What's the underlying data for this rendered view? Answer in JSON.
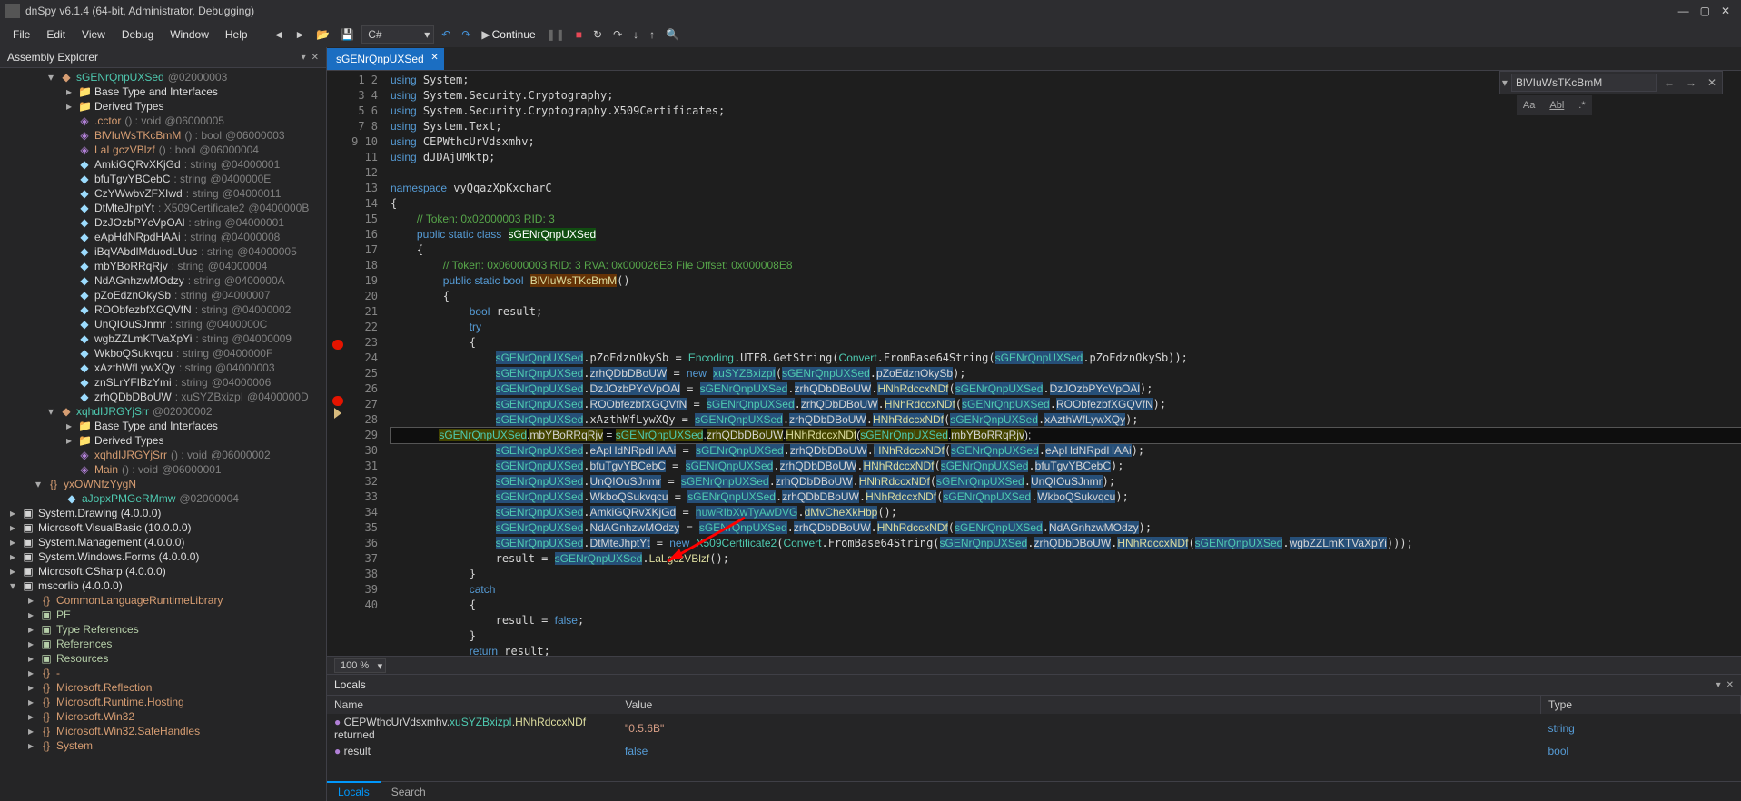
{
  "title": "dnSpy v6.1.4 (64-bit, Administrator, Debugging)",
  "menu": [
    "File",
    "Edit",
    "View",
    "Debug",
    "Window",
    "Help"
  ],
  "toolbar_lang": "C#",
  "continue_label": "Continue",
  "assembly_explorer": {
    "title": "Assembly Explorer",
    "root": {
      "name": "sGENrQnpUXSed",
      "token": "@02000003"
    },
    "base_if_label": "Base Type and Interfaces",
    "derived_label": "Derived Types",
    "members": [
      {
        "glyph": "◈",
        "name": ".cctor",
        "sig": "() : void",
        "tok": "@06000005",
        "color": "violet"
      },
      {
        "glyph": "◈",
        "name": "BlVIuWsTKcBmM",
        "sig": "() : bool",
        "tok": "@06000003",
        "color": "violet"
      },
      {
        "glyph": "◈",
        "name": "LaLgczVBlzf",
        "sig": "() : bool",
        "tok": "@06000004",
        "color": "violet"
      },
      {
        "glyph": "◆",
        "name": "AmkiGQRvXKjGd",
        "sig": " : string",
        "tok": "@04000001",
        "color": "cyan"
      },
      {
        "glyph": "◆",
        "name": "bfuTgvYBCebC",
        "sig": " : string",
        "tok": "@0400000E",
        "color": "cyan"
      },
      {
        "glyph": "◆",
        "name": "CzYWwbvZFXIwd",
        "sig": " : string",
        "tok": "@04000011",
        "color": "cyan"
      },
      {
        "glyph": "◆",
        "name": "DtMteJhptYt",
        "sig": " : X509Certificate2",
        "tok": "@0400000B",
        "color": "cyan"
      },
      {
        "glyph": "◆",
        "name": "DzJOzbPYcVpOAl",
        "sig": " : string",
        "tok": "@04000001",
        "color": "cyan"
      },
      {
        "glyph": "◆",
        "name": "eApHdNRpdHAAi",
        "sig": " : string",
        "tok": "@04000008",
        "color": "cyan"
      },
      {
        "glyph": "◆",
        "name": "iBqVAbdlMduodLUuc",
        "sig": " : string",
        "tok": "@04000005",
        "color": "cyan"
      },
      {
        "glyph": "◆",
        "name": "mbYBoRRqRjv",
        "sig": " : string",
        "tok": "@04000004",
        "color": "cyan"
      },
      {
        "glyph": "◆",
        "name": "NdAGnhzwMOdzy",
        "sig": " : string",
        "tok": "@0400000A",
        "color": "cyan"
      },
      {
        "glyph": "◆",
        "name": "pZoEdznOkySb",
        "sig": " : string",
        "tok": "@04000007",
        "color": "cyan"
      },
      {
        "glyph": "◆",
        "name": "ROObfezbfXGQVfN",
        "sig": " : string",
        "tok": "@04000002",
        "color": "cyan"
      },
      {
        "glyph": "◆",
        "name": "UnQIOuSJnmr",
        "sig": " : string",
        "tok": "@0400000C",
        "color": "cyan"
      },
      {
        "glyph": "◆",
        "name": "wgbZZLmKTVaXpYi",
        "sig": " : string",
        "tok": "@04000009",
        "color": "cyan"
      },
      {
        "glyph": "◆",
        "name": "WkboQSukvqcu",
        "sig": " : string",
        "tok": "@0400000F",
        "color": "cyan"
      },
      {
        "glyph": "◆",
        "name": "xAzthWfLywXQy",
        "sig": " : string",
        "tok": "@04000003",
        "color": "cyan"
      },
      {
        "glyph": "◆",
        "name": "znSLrYFIBzYmi",
        "sig": " : string",
        "tok": "@04000006",
        "color": "cyan"
      },
      {
        "glyph": "◆",
        "name": "zrhQDbDBoUW",
        "sig": " : xuSYZBxizpI",
        "tok": "@0400000D",
        "color": "cyan"
      }
    ],
    "class2": {
      "name": "xqhdIJRGYjSrr",
      "tok": "@02000002"
    },
    "class2_members": [
      {
        "glyph": "◈",
        "name": "xqhdIJRGYjSrr",
        "sig": "() : void",
        "tok": "@06000002",
        "color": "violet"
      },
      {
        "glyph": "◈",
        "name": "Main",
        "sig": "() : void",
        "tok": "@06000001",
        "color": "violet"
      }
    ],
    "ns2": {
      "name": "yxOWNfzYygN"
    },
    "ns2_member": {
      "glyph": "◆",
      "name": "aJopxPMGeRMmw",
      "tok": "@02000004"
    },
    "refs": [
      "System.Drawing (4.0.0.0)",
      "Microsoft.VisualBasic (10.0.0.0)",
      "System.Management (4.0.0.0)",
      "System.Windows.Forms (4.0.0.0)",
      "Microsoft.CSharp (4.0.0.0)"
    ],
    "mscorlib": "mscorlib (4.0.0.0)",
    "mscorlib_children": [
      {
        "ex": "▸",
        "ico": "{}",
        "label": "CommonLanguageRuntimeLibrary",
        "color": "orange"
      },
      {
        "ex": "▸",
        "ico": "▣",
        "label": "PE",
        "color": "green"
      },
      {
        "ex": "▸",
        "ico": "▣",
        "label": "Type References",
        "color": "green"
      },
      {
        "ex": "▸",
        "ico": "▣",
        "label": "References",
        "color": "green"
      },
      {
        "ex": "▸",
        "ico": "▣",
        "label": "Resources",
        "color": "green"
      },
      {
        "ex": "▸",
        "ico": "{}",
        "label": "-",
        "color": "orange"
      },
      {
        "ex": "▸",
        "ico": "{}",
        "label": "Microsoft.Reflection",
        "color": "orange"
      },
      {
        "ex": "▸",
        "ico": "{}",
        "label": "Microsoft.Runtime.Hosting",
        "color": "orange"
      },
      {
        "ex": "▸",
        "ico": "{}",
        "label": "Microsoft.Win32",
        "color": "orange"
      },
      {
        "ex": "▸",
        "ico": "{}",
        "label": "Microsoft.Win32.SafeHandles",
        "color": "orange"
      },
      {
        "ex": "▸",
        "ico": "{}",
        "label": "System",
        "color": "orange"
      }
    ]
  },
  "tab_name": "sGENrQnpUXSed",
  "search_value": "BlVIuWsTKcBmM",
  "search_opts": [
    "Aa",
    "Abl",
    ".*"
  ],
  "zoom": "100 %",
  "code_lines": 40,
  "locals": {
    "title": "Locals",
    "cols": [
      "Name",
      "Value",
      "Type"
    ],
    "rows": [
      {
        "ico": "●",
        "name_pre": "CEPWthcUrVdsxmhv.",
        "name_mid": "xuSYZBxizpI",
        "name_mid2": ".HNhRdccxNDf",
        "name_suf": " returned",
        "value": "\"0.5.6B\"",
        "type": "string",
        "valcls": "val"
      },
      {
        "ico": "●",
        "name_pre": "result",
        "name_mid": "",
        "name_mid2": "",
        "name_suf": "",
        "value": "false",
        "type": "bool",
        "valcls": "blueval"
      }
    ],
    "tabs": [
      "Locals",
      "Search"
    ]
  }
}
